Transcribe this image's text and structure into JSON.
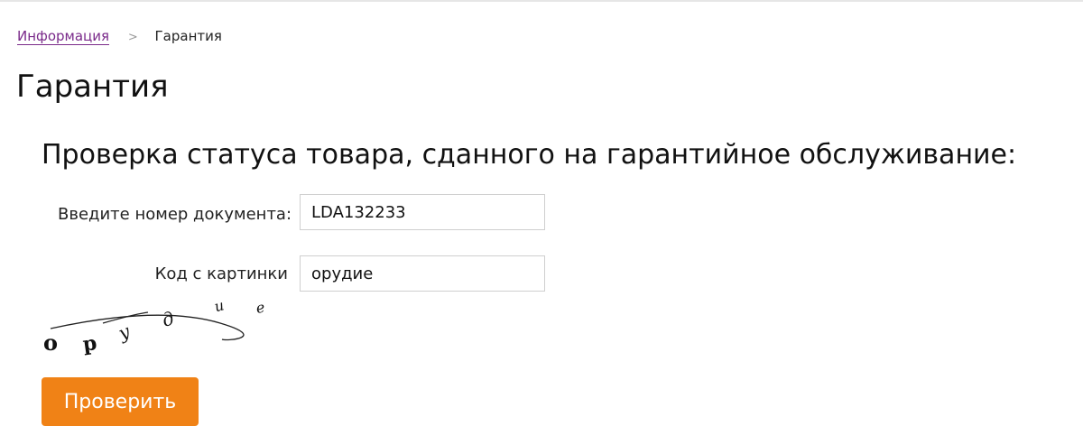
{
  "breadcrumb": {
    "parent": "Информация",
    "separator": ">",
    "current": "Гарантия"
  },
  "page": {
    "title": "Гарантия"
  },
  "form": {
    "heading": "Проверка статуса товара, сданного на гарантийное обслуживание:",
    "document_label": "Введите номер документа:",
    "document_value": "LDA132233",
    "captcha_label": "Код с картинки",
    "captcha_value": "орудие",
    "captcha_text": "орудие",
    "submit_label": "Проверить"
  },
  "colors": {
    "link": "#7a2a8a",
    "button": "#f08216"
  }
}
